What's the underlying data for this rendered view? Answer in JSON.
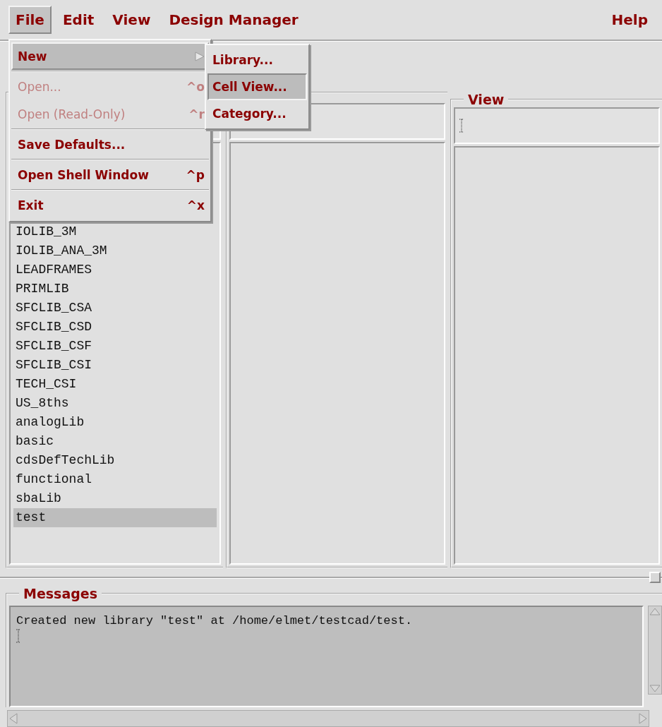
{
  "menubar": {
    "items": [
      {
        "label": "File",
        "selected": true
      },
      {
        "label": "Edit",
        "selected": false
      },
      {
        "label": "View",
        "selected": false
      },
      {
        "label": "Design Manager",
        "selected": false
      }
    ],
    "help": "Help"
  },
  "file_menu": {
    "groups": [
      {
        "items": [
          {
            "label": "New",
            "kind": "submenu",
            "highlighted": true,
            "disabled": false
          }
        ]
      },
      {
        "items": [
          {
            "label": "Open...",
            "shortcut": "^o",
            "kind": "item",
            "highlighted": false,
            "disabled": true
          },
          {
            "label": "Open (Read-Only)",
            "shortcut": "^r",
            "kind": "item",
            "highlighted": false,
            "disabled": true
          }
        ]
      },
      {
        "items": [
          {
            "label": "Save Defaults...",
            "kind": "item",
            "highlighted": false,
            "disabled": false
          }
        ]
      },
      {
        "items": [
          {
            "label": "Open Shell Window",
            "shortcut": "^p",
            "kind": "item",
            "highlighted": false,
            "disabled": false
          }
        ]
      },
      {
        "items": [
          {
            "label": "Exit",
            "shortcut": "^x",
            "kind": "item",
            "highlighted": false,
            "disabled": false
          }
        ]
      }
    ]
  },
  "new_submenu": {
    "items": [
      {
        "label": "Library...",
        "selected": false
      },
      {
        "label": "Cell View...",
        "selected": true
      },
      {
        "label": "Category...",
        "selected": false
      }
    ]
  },
  "library_column": {
    "items": [
      {
        "label": "IOLIB_3M",
        "selected": false
      },
      {
        "label": "IOLIB_ANA_3M",
        "selected": false
      },
      {
        "label": "LEADFRAMES",
        "selected": false
      },
      {
        "label": "PRIMLIB",
        "selected": false
      },
      {
        "label": "SFCLIB_CSA",
        "selected": false
      },
      {
        "label": "SFCLIB_CSD",
        "selected": false
      },
      {
        "label": "SFCLIB_CSF",
        "selected": false
      },
      {
        "label": "SFCLIB_CSI",
        "selected": false
      },
      {
        "label": "TECH_CSI",
        "selected": false
      },
      {
        "label": "US_8ths",
        "selected": false
      },
      {
        "label": "analogLib",
        "selected": false
      },
      {
        "label": "basic",
        "selected": false
      },
      {
        "label": "cdsDefTechLib",
        "selected": false
      },
      {
        "label": "functional",
        "selected": false
      },
      {
        "label": "sbaLib",
        "selected": false
      },
      {
        "label": "test",
        "selected": true
      }
    ]
  },
  "view_column": {
    "title": "View"
  },
  "messages": {
    "title": "Messages",
    "text": "Created new library \"test\" at /home/elmet/testcad/test."
  }
}
